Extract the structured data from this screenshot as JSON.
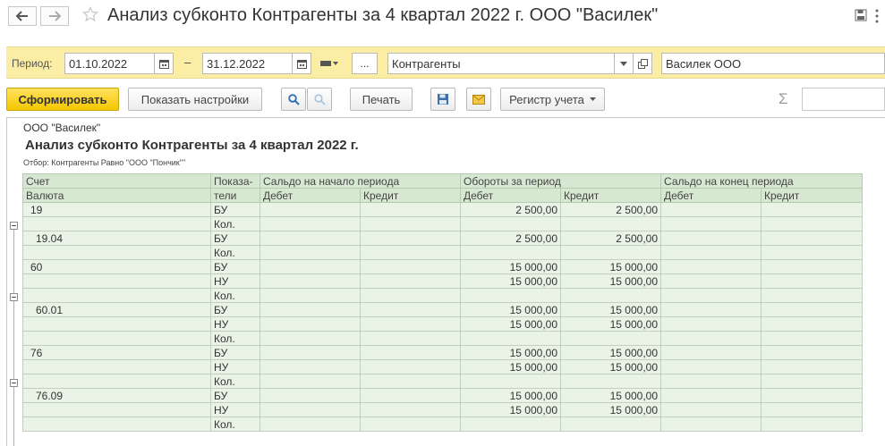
{
  "window": {
    "title": "Анализ субконто Контрагенты за 4 квартал 2022 г. ООО \"Василек\""
  },
  "icons": {
    "back": "arrow-left-icon",
    "forward": "arrow-right-icon",
    "favorite": "star-icon",
    "save": "floppy-icon",
    "more": "more-vertical-icon"
  },
  "period_panel": {
    "period_label": "Период:",
    "date_from": "01.10.2022",
    "dash": "–",
    "date_to": "31.12.2022",
    "ellipsis_label": "...",
    "subconto_type": "Контрагенты",
    "organization": "Василек ООО"
  },
  "toolbar": {
    "generate_label": "Сформировать",
    "show_settings_label": "Показать настройки",
    "print_label": "Печать",
    "register_label": "Регистр учета",
    "sigma_label": "Σ"
  },
  "report": {
    "organization": "ООО \"Василек\"",
    "title": "Анализ субконто Контрагенты за 4 квартал 2022 г.",
    "filter": "Отбор: Контрагенты Равно \"ООО \"Пончик\"\"",
    "headers": {
      "account": "Счет",
      "currency": "Валюта",
      "indicator_1": "Показа-",
      "indicator_2": "тели",
      "opening_balance": "Сальдо на начало периода",
      "turnover": "Обороты за период",
      "closing_balance": "Сальдо на конец периода",
      "debit": "Дебет",
      "credit": "Кредит"
    },
    "rows": [
      {
        "account": "19",
        "indicator": "БУ",
        "turnover_debit": "2 500,00",
        "turnover_credit": "2 500,00"
      },
      {
        "account": "",
        "indicator": "Кол.",
        "turnover_debit": "",
        "turnover_credit": ""
      },
      {
        "account": "19.04",
        "indicator": "БУ",
        "turnover_debit": "2 500,00",
        "turnover_credit": "2 500,00"
      },
      {
        "account": "",
        "indicator": "Кол.",
        "turnover_debit": "",
        "turnover_credit": ""
      },
      {
        "account": "60",
        "indicator": "БУ",
        "turnover_debit": "15 000,00",
        "turnover_credit": "15 000,00"
      },
      {
        "account": "",
        "indicator": "НУ",
        "turnover_debit": "15 000,00",
        "turnover_credit": "15 000,00"
      },
      {
        "account": "",
        "indicator": "Кол.",
        "turnover_debit": "",
        "turnover_credit": ""
      },
      {
        "account": "60.01",
        "indicator": "БУ",
        "turnover_debit": "15 000,00",
        "turnover_credit": "15 000,00"
      },
      {
        "account": "",
        "indicator": "НУ",
        "turnover_debit": "15 000,00",
        "turnover_credit": "15 000,00"
      },
      {
        "account": "",
        "indicator": "Кол.",
        "turnover_debit": "",
        "turnover_credit": ""
      },
      {
        "account": "76",
        "indicator": "БУ",
        "turnover_debit": "15 000,00",
        "turnover_credit": "15 000,00"
      },
      {
        "account": "",
        "indicator": "НУ",
        "turnover_debit": "15 000,00",
        "turnover_credit": "15 000,00"
      },
      {
        "account": "",
        "indicator": "Кол.",
        "turnover_debit": "",
        "turnover_credit": ""
      },
      {
        "account": "76.09",
        "indicator": "БУ",
        "turnover_debit": "15 000,00",
        "turnover_credit": "15 000,00"
      },
      {
        "account": "",
        "indicator": "НУ",
        "turnover_debit": "15 000,00",
        "turnover_credit": "15 000,00"
      },
      {
        "account": "",
        "indicator": "Кол.",
        "turnover_debit": "",
        "turnover_credit": ""
      }
    ]
  }
}
